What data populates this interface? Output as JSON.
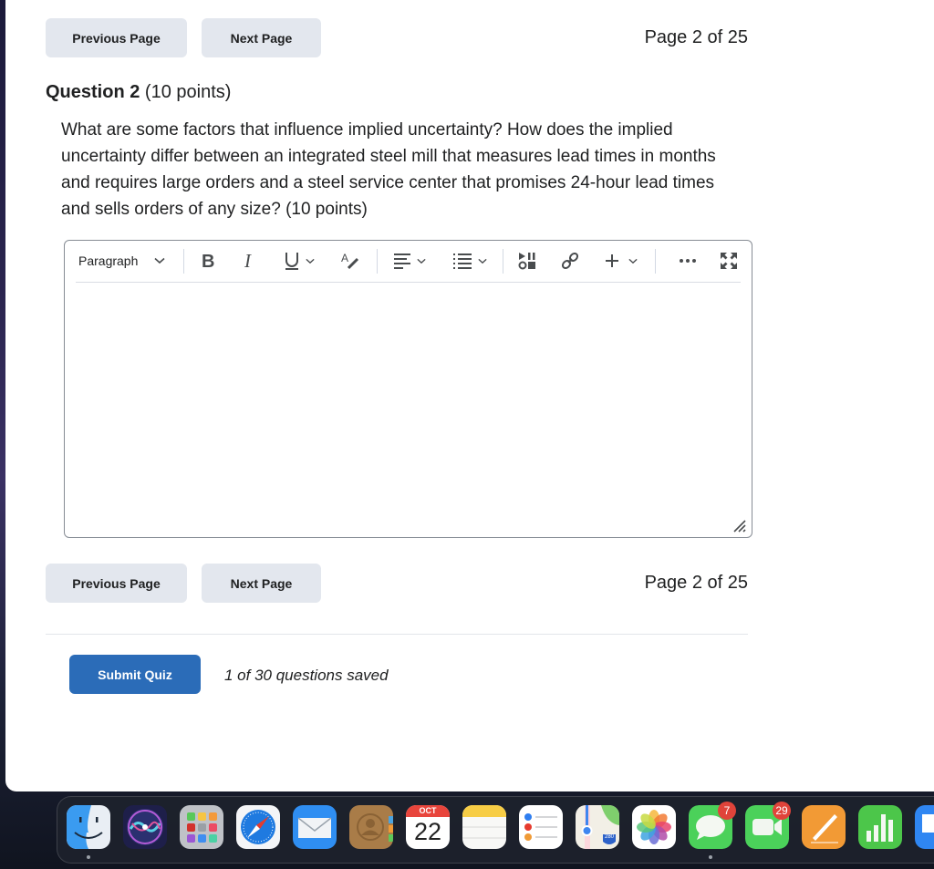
{
  "navigation": {
    "previous_label": "Previous Page",
    "next_label": "Next Page",
    "page_indicator": "Page 2 of 25"
  },
  "question": {
    "number_label": "Question 2",
    "points_label": "(10 points)",
    "text": "What are some factors that influence implied uncertainty?  How does the implied uncertainty differ between an integrated steel mill that measures lead times in months and requires large orders and a steel service center that promises 24-hour lead times and sells orders of any size? (10 points)"
  },
  "editor": {
    "block_format": "Paragraph",
    "toolbar_icons": [
      "chevron-down-icon",
      "bold-icon",
      "italic-icon",
      "underline-icon",
      "format-painter-icon",
      "align-icon",
      "list-icon",
      "media-icon",
      "link-icon",
      "insert-icon",
      "more-icon",
      "fullscreen-icon"
    ],
    "content": ""
  },
  "footer": {
    "submit_label": "Submit Quiz",
    "save_status": "1 of 30 questions saved"
  },
  "dock": {
    "items": [
      {
        "name": "Finder",
        "running": true
      },
      {
        "name": "Siri"
      },
      {
        "name": "Launchpad"
      },
      {
        "name": "Safari"
      },
      {
        "name": "Mail"
      },
      {
        "name": "Contacts"
      },
      {
        "name": "Calendar",
        "month": "OCT",
        "day": "22"
      },
      {
        "name": "Notes"
      },
      {
        "name": "Reminders"
      },
      {
        "name": "Maps",
        "shield": "280"
      },
      {
        "name": "Photos"
      },
      {
        "name": "Messages",
        "badge": "7",
        "running": true
      },
      {
        "name": "FaceTime",
        "badge": "29"
      },
      {
        "name": "Pages"
      },
      {
        "name": "Numbers"
      },
      {
        "name": "Keynote"
      }
    ]
  }
}
